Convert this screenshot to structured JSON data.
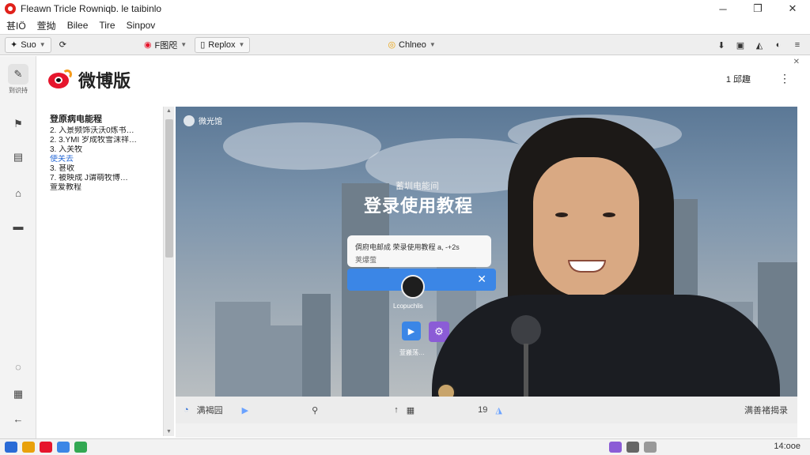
{
  "window": {
    "title": "Fleawn Tricle Rowniqb. le taibinlo",
    "minimize": "─",
    "restore": "❐",
    "close": "✕"
  },
  "menu": [
    "甚IÖ",
    "萱拗",
    "Bilee",
    "Tire",
    "Sinpov"
  ],
  "toolbar": {
    "back": "Suo",
    "tab1": "F图咫",
    "tab2": "Replox",
    "center": "Chlneo",
    "right_icons": [
      "⬇",
      "▣",
      "◭",
      "◐",
      "≡"
    ]
  },
  "leftbar": {
    "first_label": "到识持",
    "icons": [
      "✎",
      "▤",
      "⌂",
      "▬",
      "◌",
      "▦",
      "←"
    ]
  },
  "header": {
    "brand": "微博版",
    "right_text": "1 邱趣",
    "more": "⋮",
    "close": "✕"
  },
  "sidelist": {
    "title": "登原病电能程",
    "items": [
      "2. 入景频饰沃沃0炼书…",
      "2. 3.YMI 岁成牧雪沫祥…",
      "3. 入关牧",
      "使关去",
      "3. 甚收",
      "7. 被映成 J谓萌牧博…",
      "萱爱教程"
    ]
  },
  "video": {
    "tag": "微光馆",
    "subtitle": "蓄圳电能间",
    "title": "登录使用教程",
    "popup_line1": "倜府电邮成 荣录使用教程 a, -+2s",
    "popup_line2": "荚爆萤",
    "close": "✕",
    "avatar_name": "Lcopuchlis",
    "play": "▶",
    "gear": "⚙",
    "button_label": "萱搬荡…"
  },
  "controls": {
    "left": "满褐园",
    "progress": "19",
    "right": "满善褚揭录"
  },
  "taskbar": {
    "time": "14:ooe"
  }
}
